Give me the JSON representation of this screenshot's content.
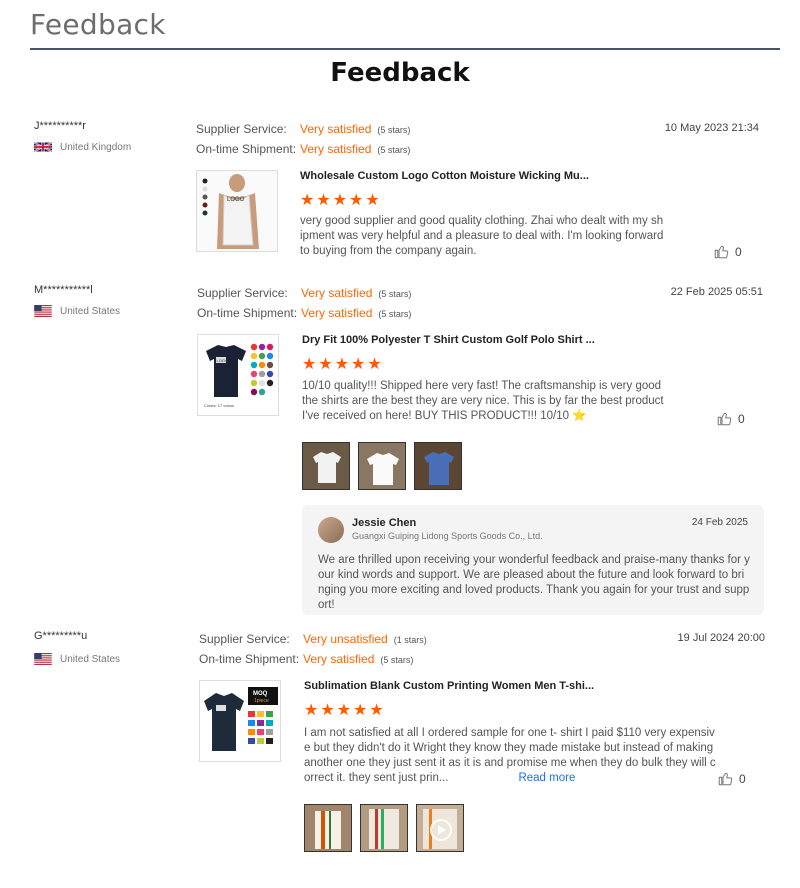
{
  "page_header": "Feedback",
  "title": "Feedback",
  "labels": {
    "supplier_service": "Supplier Service:",
    "ontime_shipment": "On-time Shipment:"
  },
  "colors": {
    "accent": "#ff6600",
    "link": "#1a73e8",
    "header_rule": "#4b5568"
  },
  "reviews": [
    {
      "reviewer": "J**********r",
      "country": "United Kingdom",
      "flag_icon": "uk-flag-icon",
      "supplier_service": "Very satisfied",
      "supplier_service_stars": "(5 stars)",
      "shipment": "Very satisfied",
      "shipment_stars": "(5 stars)",
      "date": "10 May 2023 21:34",
      "product_title": "Wholesale Custom Logo Cotton Moisture Wicking Mu...",
      "product_image_text": "LOGO",
      "rating": 5,
      "text": "very good supplier and good quality clothing. Zhai who dealt with my shipment was very helpful and a pleasure to deal with. I'm looking forward to buying from the company again.",
      "likes": "0"
    },
    {
      "reviewer": "M***********l",
      "country": "United States",
      "flag_icon": "us-flag-icon",
      "supplier_service": "Very satisfied",
      "supplier_service_stars": "(5 stars)",
      "shipment": "Very satisfied",
      "shipment_stars": "(5 stars)",
      "date": "22 Feb 2025 05:51",
      "product_title": "Dry Fit 100% Polyester T Shirt Custom Golf Polo Shirt ...",
      "product_image_text": "LOGO",
      "product_image_caption": "Colors: 17 colors",
      "rating": 5,
      "text": "10/10 quality!!! Shipped here very fast! The craftsmanship is very good the shirts are the best they are very nice. This is by far the best product I've received on here! BUY THIS PRODUCT!!! 10/10 ⭐",
      "likes": "0",
      "reply": {
        "name": "Jessie Chen",
        "company": "Guangxi Guiping Lidong Sports Goods Co., Ltd.",
        "date": "24 Feb 2025",
        "text": "We are thrilled upon receiving your wonderful feedback and praise-many thanks for your kind words and support. We are pleased about the future and look forward to bringing you more exciting and loved products. Thank you again for your trust and support!"
      }
    },
    {
      "reviewer": "G*********u",
      "country": "United States",
      "flag_icon": "us-flag-icon",
      "supplier_service": "Very unsatisfied",
      "supplier_service_stars": "(1 stars)",
      "shipment": "Very satisfied",
      "shipment_stars": "(5 stars)",
      "date": "19 Jul 2024 20:00",
      "product_title": "Sublimation Blank Custom Printing Women Men T-shi...",
      "product_image_text": "MOQ",
      "product_image_subtext": "1piece",
      "rating": 5,
      "text": "I am not satisfied at all I ordered sample for one t- shirt I paid $110 very expensive but they didn't do it Wright they know they made mistake but instead of making another one they just sent it as it is and promise me when they do bulk they will correct it. they sent just prin...",
      "read_more": "Read more",
      "likes": "0"
    }
  ]
}
